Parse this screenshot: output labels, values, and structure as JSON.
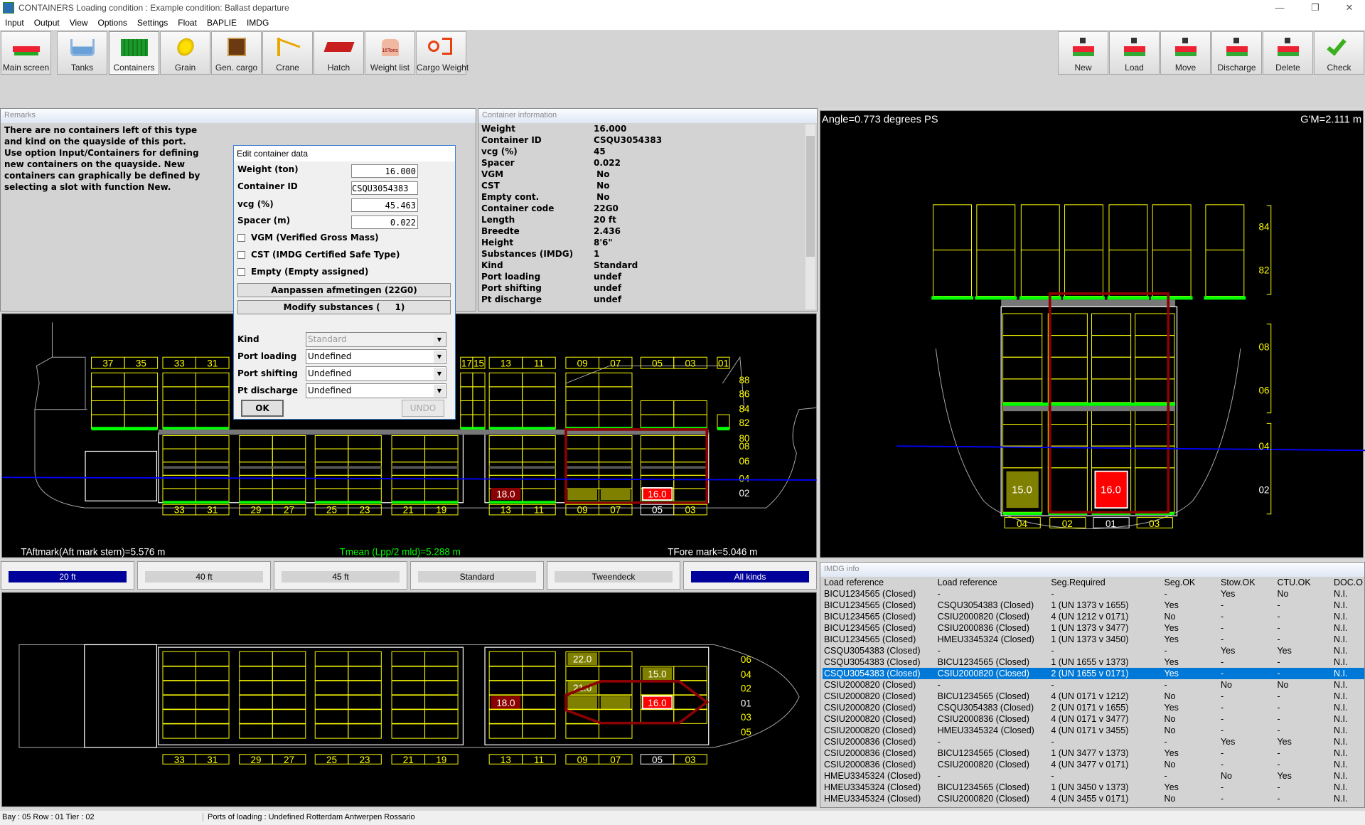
{
  "window": {
    "app": "CONTAINERS",
    "title": "Loading condition : Example condition: Ballast departure",
    "controls": [
      "—",
      "❐",
      "✕"
    ]
  },
  "menu": [
    "Input",
    "Output",
    "View",
    "Options",
    "Settings",
    "Float",
    "BAPLIE",
    "IMDG"
  ],
  "toolbar_left": [
    {
      "label": "Main screen",
      "icon": "ship-icon"
    },
    {
      "label": "Tanks",
      "icon": "tanks-icon"
    },
    {
      "label": "Containers",
      "icon": "container-icon",
      "active": true
    },
    {
      "label": "Grain",
      "icon": "grain-icon"
    },
    {
      "label": "Gen. cargo",
      "icon": "box-icon"
    },
    {
      "label": "Crane",
      "icon": "crane-icon"
    },
    {
      "label": "Hatch",
      "icon": "hatch-icon"
    },
    {
      "label": "Weight list",
      "icon": "weight-icon",
      "icon_text": "16Tons"
    },
    {
      "label": "Cargo Weight",
      "icon": "cargo-weight-icon"
    }
  ],
  "toolbar_right": [
    {
      "label": "New",
      "icon": "new-container-icon"
    },
    {
      "label": "Load",
      "icon": "load-container-icon"
    },
    {
      "label": "Move",
      "icon": "move-container-icon"
    },
    {
      "label": "Discharge",
      "icon": "discharge-container-icon"
    },
    {
      "label": "Delete",
      "icon": "delete-container-icon"
    },
    {
      "label": "Check",
      "icon": "check-icon"
    }
  ],
  "remarks": {
    "title": "Remarks",
    "text": "There are no containers left of this type and kind on the quayside of this port. Use option Input/Containers for defining new containers on the quayside. New containers can graphically be defined by selecting a slot with function New."
  },
  "container_info": {
    "title": "Container information",
    "rows": [
      [
        "Weight",
        "16.000"
      ],
      [
        "Container ID",
        "CSQU3054383"
      ],
      [
        "vcg (%)",
        "45"
      ],
      [
        "Spacer",
        "0.022"
      ],
      [
        "VGM",
        " No"
      ],
      [
        "CST",
        " No"
      ],
      [
        "Empty cont.",
        " No"
      ],
      [
        "Container code",
        "22G0"
      ],
      [
        "Length",
        "20 ft"
      ],
      [
        "Breedte",
        "2.436"
      ],
      [
        "Height",
        "8'6\""
      ],
      [
        "Substances (IMDG)",
        "1"
      ],
      [
        "Kind",
        "Standard"
      ],
      [
        "Port loading",
        "undef"
      ],
      [
        "Port shifting",
        "undef"
      ],
      [
        "Pt discharge",
        "undef"
      ]
    ]
  },
  "dialog": {
    "title": "Edit container data",
    "weight_label": "Weight (ton)",
    "weight": "16.000",
    "id_label": "Container ID",
    "id": "CSQU3054383",
    "vcg_label": "vcg (%)",
    "vcg": "45.463",
    "spacer_label": "Spacer (m)",
    "spacer": "0.022",
    "vgm_label": "VGM (Verified Gross Mass)",
    "vgm": false,
    "cst_label": "CST (IMDG Certified Safe Type)",
    "cst": false,
    "empty_label": "Empty (Empty assigned)",
    "empty": false,
    "dims_button": "Aanpassen afmetingen (22G0)",
    "substances_button": "Modify substances (     1)",
    "kind_label": "Kind",
    "kind": "Standard",
    "port_loading_label": "Port loading",
    "port_loading": "Undefined",
    "port_shifting_label": "Port shifting",
    "port_shifting": "Undefined",
    "pt_discharge_label": "Pt discharge",
    "pt_discharge": "Undefined",
    "ok": "OK",
    "undo": "UNDO"
  },
  "profile": {
    "top_bays": [
      "37",
      "35",
      "33",
      "31",
      "17",
      "15",
      "13",
      "11",
      "09",
      "07",
      "05",
      "03",
      "01"
    ],
    "bottom_bays": [
      "33",
      "31",
      "29",
      "27",
      "25",
      "23",
      "21",
      "19",
      "13",
      "11",
      "09",
      "07",
      "05",
      "03"
    ],
    "tiers": [
      "88",
      "86",
      "84",
      "82",
      "80",
      "08",
      "06",
      "04",
      "02"
    ],
    "containers": [
      {
        "bay": "13",
        "tier": "02",
        "weight": "18.0",
        "color": "#8b0000"
      },
      {
        "bay": "05",
        "tier": "02",
        "weight": "16.0",
        "color": "#ff0000"
      },
      {
        "bay": "09",
        "tier": "02",
        "weight": "",
        "color": "#808000"
      },
      {
        "bay": "07",
        "tier": "02",
        "weight": "",
        "color": "#808000"
      }
    ],
    "aft_draught": "TAftmark(Aft mark stern)=5.576 m",
    "mean_draught": "Tmean (Lpp/2 mld)=5.288 m",
    "fore_draught": "TFore mark=5.046 m",
    "selected_bay": "05"
  },
  "filters": [
    {
      "label": "20 ft",
      "on": true
    },
    {
      "label": "40 ft",
      "on": false
    },
    {
      "label": "45 ft",
      "on": false
    },
    {
      "label": "Standard",
      "on": false
    },
    {
      "label": "Tweendeck",
      "on": false
    },
    {
      "label": "All kinds",
      "on": true
    }
  ],
  "plan": {
    "bays": [
      "33",
      "31",
      "29",
      "27",
      "25",
      "23",
      "21",
      "19",
      "13",
      "11",
      "09",
      "07",
      "05",
      "03"
    ],
    "rows": [
      "06",
      "04",
      "02",
      "01",
      "03",
      "05"
    ],
    "containers": [
      {
        "bay": "09",
        "row": "06",
        "weight": "22.0",
        "color": "#808000"
      },
      {
        "bay": "05",
        "row": "04",
        "weight": "15.0",
        "color": "#808000"
      },
      {
        "bay": "09",
        "row": "02",
        "weight": "21.0",
        "color": "#808000"
      },
      {
        "bay": "13",
        "row": "01",
        "weight": "18.0",
        "color": "#8b0000"
      },
      {
        "bay": "09",
        "row": "01",
        "weight": "",
        "color": "#808000"
      },
      {
        "bay": "07",
        "row": "01",
        "weight": "",
        "color": "#808000"
      },
      {
        "bay": "05",
        "row": "01",
        "weight": "16.0",
        "color": "#ff0000"
      }
    ]
  },
  "section": {
    "angle": "Angle=0.773 degrees PS",
    "gm": "G'M=2.111 m",
    "tiers": [
      "84",
      "82",
      "08",
      "06",
      "04",
      "02"
    ],
    "rows": [
      "04",
      "02",
      "01",
      "03"
    ],
    "containers": [
      {
        "row": "04",
        "tier": "02",
        "weight": "15.0",
        "color": "#808000"
      },
      {
        "row": "01",
        "tier": "02",
        "weight": "16.0",
        "color": "#ff0000"
      }
    ],
    "selected_row": "01"
  },
  "imdg": {
    "title": "IMDG info",
    "columns": [
      "Load reference",
      "Load reference",
      "Seg.Required",
      "Seg.OK",
      "Stow.OK",
      "CTU.OK",
      "DOC.O"
    ],
    "rows": [
      [
        "BICU1234565 (Closed)",
        "-",
        "-",
        "-",
        "Yes",
        "No",
        "N.I."
      ],
      [
        "BICU1234565 (Closed)",
        "CSQU3054383 (Closed)",
        "1 (UN 1373 v 1655)",
        "Yes",
        "-",
        "-",
        "N.I."
      ],
      [
        "BICU1234565 (Closed)",
        "CSIU2000820 (Closed)",
        "4 (UN 1212 v 0171)",
        "No",
        "-",
        "-",
        "N.I."
      ],
      [
        "BICU1234565 (Closed)",
        "CSIU2000836 (Closed)",
        "1 (UN 1373 v 3477)",
        "Yes",
        "-",
        "-",
        "N.I."
      ],
      [
        "BICU1234565 (Closed)",
        "HMEU3345324 (Closed)",
        "1 (UN 1373 v 3450)",
        "Yes",
        "-",
        "-",
        "N.I."
      ],
      [
        "CSQU3054383 (Closed)",
        "-",
        "-",
        "-",
        "Yes",
        "Yes",
        "N.I."
      ],
      [
        "CSQU3054383 (Closed)",
        "BICU1234565 (Closed)",
        "1 (UN 1655 v 1373)",
        "Yes",
        "-",
        "-",
        "N.I."
      ],
      [
        "CSQU3054383 (Closed)",
        "CSIU2000820 (Closed)",
        "2 (UN 1655 v 0171)",
        "Yes",
        "-",
        "-",
        "N.I."
      ],
      [
        "CSIU2000820 (Closed)",
        "-",
        "-",
        "-",
        "No",
        "No",
        "N.I."
      ],
      [
        "CSIU2000820 (Closed)",
        "BICU1234565 (Closed)",
        "4 (UN 0171 v 1212)",
        "No",
        "-",
        "-",
        "N.I."
      ],
      [
        "CSIU2000820 (Closed)",
        "CSQU3054383 (Closed)",
        "2 (UN 0171 v 1655)",
        "Yes",
        "-",
        "-",
        "N.I."
      ],
      [
        "CSIU2000820 (Closed)",
        "CSIU2000836 (Closed)",
        "4 (UN 0171 v 3477)",
        "No",
        "-",
        "-",
        "N.I."
      ],
      [
        "CSIU2000820 (Closed)",
        "HMEU3345324 (Closed)",
        "4 (UN 0171 v 3455)",
        "No",
        "-",
        "-",
        "N.I."
      ],
      [
        "CSIU2000836 (Closed)",
        "-",
        "-",
        "-",
        "Yes",
        "Yes",
        "N.I."
      ],
      [
        "CSIU2000836 (Closed)",
        "BICU1234565 (Closed)",
        "1 (UN 3477 v 1373)",
        "Yes",
        "-",
        "-",
        "N.I."
      ],
      [
        "CSIU2000836 (Closed)",
        "CSIU2000820 (Closed)",
        "4 (UN 3477 v 0171)",
        "No",
        "-",
        "-",
        "N.I."
      ],
      [
        "HMEU3345324 (Closed)",
        "-",
        "-",
        "-",
        "No",
        "Yes",
        "N.I."
      ],
      [
        "HMEU3345324 (Closed)",
        "BICU1234565 (Closed)",
        "1 (UN 3450 v 1373)",
        "Yes",
        "-",
        "-",
        "N.I."
      ],
      [
        "HMEU3345324 (Closed)",
        "CSIU2000820 (Closed)",
        "4 (UN 3455 v 0171)",
        "No",
        "-",
        "-",
        "N.I."
      ]
    ],
    "selected_row": 7
  },
  "status": {
    "position": "Bay : 05  Row : 01  Tier : 02",
    "ports": "Ports of loading :  Undefined Rotterdam Antwerpen Rossario"
  },
  "colors": {
    "grid": "#ffff00",
    "deck_line": "#00ff00",
    "waterline": "#0000ff",
    "selection": "#8b0000",
    "highlight_bar": "#00009a",
    "selected_row": "#0078d7"
  }
}
